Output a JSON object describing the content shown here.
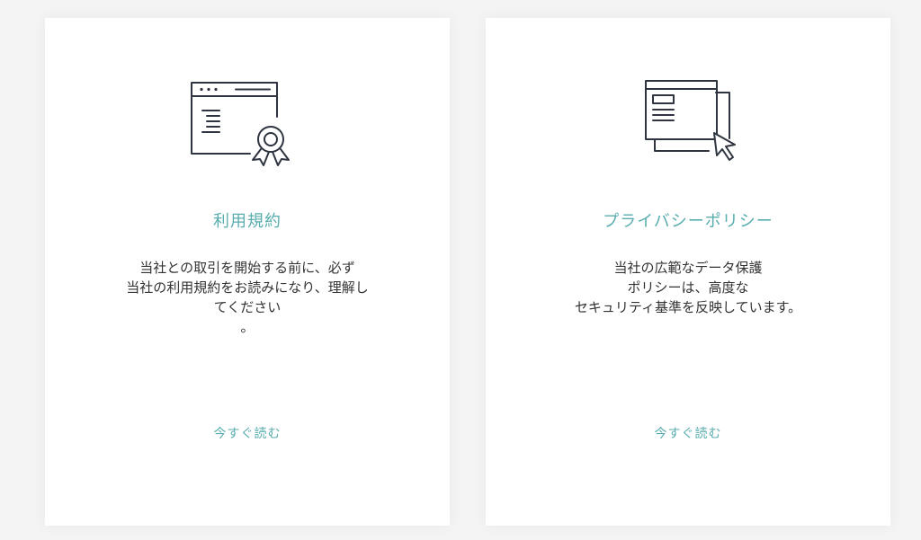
{
  "colors": {
    "accent": "#5aadaf",
    "text": "#333333",
    "icon_stroke": "#2f3540"
  },
  "cards": [
    {
      "icon": "certificate-window-icon",
      "title": "利用規約",
      "description_lines": [
        "当社との取引を開始する前に、必ず",
        "当社の利用規約をお読みになり、理解し",
        "てください",
        "。"
      ],
      "link": "今すぐ読む"
    },
    {
      "icon": "window-pointer-icon",
      "title": "プライバシーポリシー",
      "description_lines": [
        "当社の広範なデータ保護",
        "ポリシーは、高度な",
        "セキュリティ基準を反映しています。"
      ],
      "link": "今すぐ読む"
    }
  ]
}
